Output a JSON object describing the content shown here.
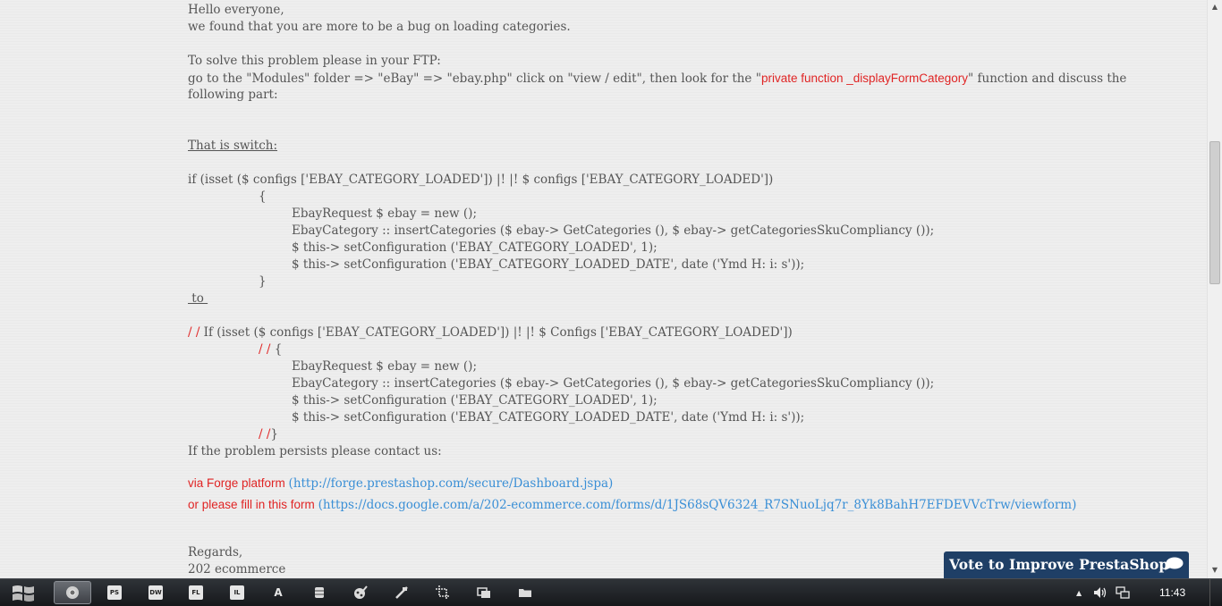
{
  "post": {
    "greeting": "Hello everyone,",
    "intro": "we found that you are more to be a bug on loading categories.",
    "solve_heading": "To solve this problem please in your FTP:",
    "instr_part1": "go to the \"Modules\" folder => \"eBay\" => \"ebay.php\" click on \"view / edit\", then look for the \"",
    "instr_highlight": "private function _displayFormCategory",
    "instr_part2": "\" function and discuss the",
    "instr_line2": "following part:",
    "switch_label": "That is switch:",
    "code_before": {
      "if_line": "if (isset ($ configs ['EBAY_CATEGORY_LOADED']) |! |! $ configs ['EBAY_CATEGORY_LOADED'])",
      "open_brace": "{",
      "line1": "EbayRequest $ ebay = new ();",
      "line2": "EbayCategory :: insertCategories ($ ebay-> GetCategories (), $ ebay-> getCategoriesSkuCompliancy ());",
      "line3": "$ this-> setConfiguration ('EBAY_CATEGORY_LOADED', 1);",
      "line4": "$ this-> setConfiguration ('EBAY_CATEGORY_LOADED_DATE', date ('Ymd H: i: s'));",
      "close_brace": "}"
    },
    "to_label": " to ",
    "code_after": {
      "comment_mark": "/ /",
      "if_line": " If (isset ($ configs ['EBAY_CATEGORY_LOADED']) |! |! $ Configs ['EBAY_CATEGORY_LOADED'])",
      "open_mark": "/ /",
      "open_brace": "{",
      "line1": "EbayRequest $ ebay = new ();",
      "line2": "EbayCategory :: insertCategories ($ ebay-> GetCategories (), $ ebay-> getCategoriesSkuCompliancy ());",
      "line3": "$ this-> setConfiguration ('EBAY_CATEGORY_LOADED', 1);",
      "line4": "$ this-> setConfiguration ('EBAY_CATEGORY_LOADED_DATE', date ('Ymd H: i: s'));",
      "close_mark": "/ /",
      "close_brace": "}"
    },
    "persist_text": "If the problem persists please contact us:",
    "forge_label": "via Forge platform ",
    "forge_link": "(http://forge.prestashop.com/secure/Dashboard.jspa)",
    "form_label": "or please fill in this form ",
    "form_link": "(https://docs.google.com/a/202-ecommerce.com/forms/d/1JS68sQV6324_R7SNuoLjq7r_8Yk8BahH7EFDEVVcTrw/viewform)",
    "regards": "Regards,",
    "signature": "202 ecommerce"
  },
  "vote_button": {
    "label": "Vote to Improve PrestaShop",
    "icon": "speech-bubble-icon"
  },
  "taskbar": {
    "apps": [
      {
        "name": "chrome",
        "label": ""
      },
      {
        "name": "photoshop",
        "label": "PS"
      },
      {
        "name": "dreamweaver",
        "label": "DW"
      },
      {
        "name": "flash",
        "label": "FL"
      },
      {
        "name": "illustrator",
        "label": "IL"
      },
      {
        "name": "app-a",
        "label": "A"
      }
    ],
    "clock": "11:43"
  },
  "colors": {
    "accent_red": "#e02424",
    "link_blue": "#3a8fd6",
    "vote_bg": "#1f3f66"
  }
}
